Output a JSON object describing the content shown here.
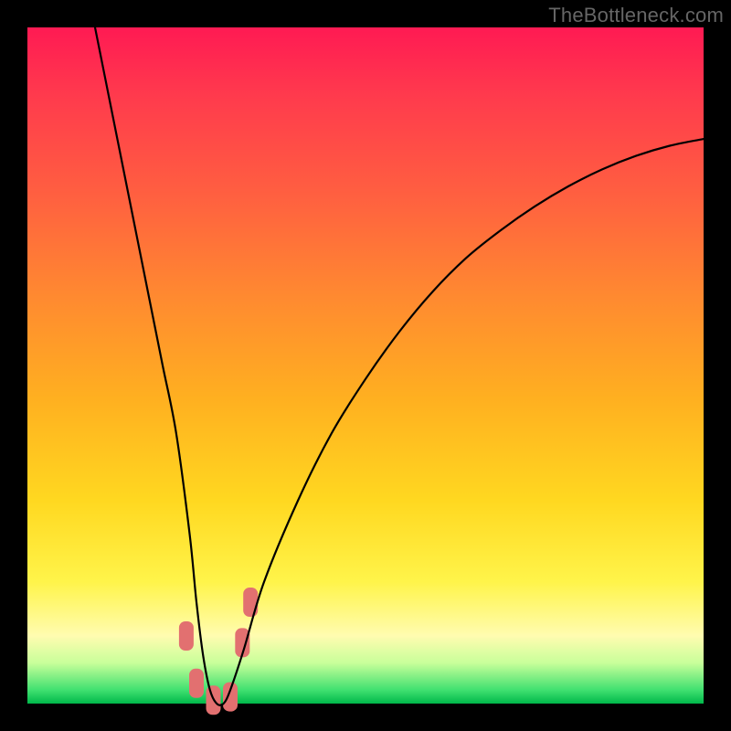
{
  "watermark": "TheBottleneck.com",
  "chart_data": {
    "type": "line",
    "title": "",
    "xlabel": "",
    "ylabel": "",
    "xlim": [
      0,
      100
    ],
    "ylim": [
      0,
      100
    ],
    "series": [
      {
        "name": "bottleneck-curve",
        "x": [
          10,
          12,
          14,
          16,
          18,
          20,
          22,
          24,
          25,
          26,
          27,
          28,
          29,
          30,
          32,
          35,
          40,
          45,
          50,
          55,
          60,
          65,
          70,
          75,
          80,
          85,
          90,
          95,
          100
        ],
        "y": [
          100,
          90,
          80,
          70,
          60,
          50,
          40,
          25,
          15,
          7,
          2,
          0,
          0,
          2,
          8,
          18,
          30,
          40,
          48,
          55,
          61,
          66,
          70,
          73.5,
          76.5,
          79,
          81,
          82.5,
          83.5
        ]
      }
    ],
    "markers": [
      {
        "name": "threshold-marker",
        "x": 23.5,
        "y": 10,
        "color": "#e27070"
      },
      {
        "name": "threshold-marker",
        "x": 25.0,
        "y": 3,
        "color": "#e27070"
      },
      {
        "name": "threshold-marker",
        "x": 27.5,
        "y": 0.5,
        "color": "#e27070"
      },
      {
        "name": "threshold-marker",
        "x": 30.0,
        "y": 1,
        "color": "#e27070"
      },
      {
        "name": "threshold-marker",
        "x": 31.8,
        "y": 9,
        "color": "#e27070"
      },
      {
        "name": "threshold-marker",
        "x": 33.0,
        "y": 15,
        "color": "#e27070"
      }
    ],
    "gradient_stops": [
      {
        "pos": 0.0,
        "color": "#ff1a53"
      },
      {
        "pos": 0.1,
        "color": "#ff3a4d"
      },
      {
        "pos": 0.25,
        "color": "#ff6040"
      },
      {
        "pos": 0.4,
        "color": "#ff8a30"
      },
      {
        "pos": 0.55,
        "color": "#ffb020"
      },
      {
        "pos": 0.7,
        "color": "#ffd820"
      },
      {
        "pos": 0.82,
        "color": "#fff44a"
      },
      {
        "pos": 0.9,
        "color": "#fffcb0"
      },
      {
        "pos": 0.94,
        "color": "#c8ff9a"
      },
      {
        "pos": 0.98,
        "color": "#40e070"
      },
      {
        "pos": 1.0,
        "color": "#00b84a"
      }
    ]
  }
}
